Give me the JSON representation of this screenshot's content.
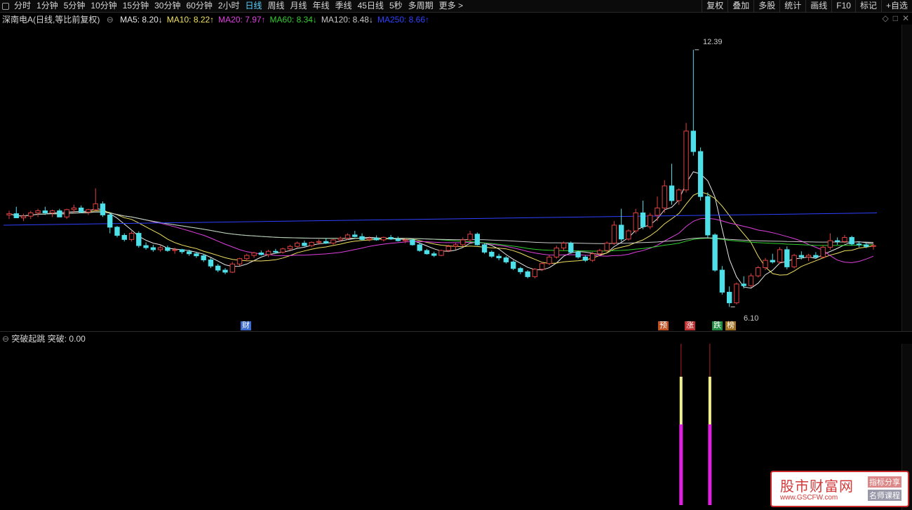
{
  "toolbar": {
    "periods": [
      {
        "label": "分时",
        "active": false
      },
      {
        "label": "1分钟",
        "active": false
      },
      {
        "label": "5分钟",
        "active": false
      },
      {
        "label": "10分钟",
        "active": false
      },
      {
        "label": "15分钟",
        "active": false
      },
      {
        "label": "30分钟",
        "active": false
      },
      {
        "label": "60分钟",
        "active": false
      },
      {
        "label": "2小时",
        "active": false
      },
      {
        "label": "日线",
        "active": true
      },
      {
        "label": "周线",
        "active": false
      },
      {
        "label": "月线",
        "active": false
      },
      {
        "label": "年线",
        "active": false
      },
      {
        "label": "季线",
        "active": false
      },
      {
        "label": "45日线",
        "active": false
      },
      {
        "label": "5秒",
        "active": false
      },
      {
        "label": "多周期",
        "active": false
      },
      {
        "label": "更多 >",
        "active": false
      }
    ],
    "right": [
      "复权",
      "叠加",
      "多股",
      "统计",
      "画线",
      "F10",
      "标记",
      "+自选"
    ]
  },
  "legend": {
    "stock": "深南电A(日线,等比前复权)",
    "ma": [
      {
        "label": "MA5: 8.20↓",
        "color": "#e6e6e6"
      },
      {
        "label": "MA10: 8.22↑",
        "color": "#f0e060"
      },
      {
        "label": "MA20: 7.97↑",
        "color": "#e040e0"
      },
      {
        "label": "MA60: 8.34↓",
        "color": "#30d030"
      },
      {
        "label": "MA120: 8.48↓",
        "color": "#c8c8c8"
      },
      {
        "label": "MA250: 8.66↑",
        "color": "#3040ff"
      }
    ],
    "controls": [
      "◇",
      "□",
      "✕"
    ]
  },
  "price_labels": {
    "high": "12.39",
    "low": "6.10"
  },
  "events": [
    {
      "label": "财",
      "color": "#3a6acb"
    },
    {
      "label": "预",
      "color": "#c05020"
    },
    {
      "label": "涨",
      "color": "#c03030"
    },
    {
      "label": "跌",
      "color": "#208a40"
    },
    {
      "label": "榜",
      "color": "#a07020"
    }
  ],
  "sub_panel": {
    "title": "突破起跳",
    "value_label": "突破: 0.00"
  },
  "watermark": {
    "name": "股市财富网",
    "url": "www.GSCFW.com",
    "tag1": "指标分享",
    "tag2": "名师课程"
  },
  "colors": {
    "up": "#e04040",
    "down": "#4ee0e8",
    "ma5": "#e6e6e6",
    "ma10": "#f0e060",
    "ma20": "#e040e0",
    "ma60": "#30d030",
    "ma120": "#c8c8c8",
    "ma250": "#3040ff"
  },
  "chart_data": {
    "type": "candlestick",
    "ylim": [
      5.8,
      12.8
    ],
    "candles": [
      [
        8.35,
        8.45,
        8.25,
        8.38
      ],
      [
        8.38,
        8.55,
        8.3,
        8.28
      ],
      [
        8.28,
        8.38,
        8.2,
        8.32
      ],
      [
        8.32,
        8.45,
        8.25,
        8.4
      ],
      [
        8.4,
        8.5,
        8.3,
        8.45
      ],
      [
        8.45,
        8.55,
        8.35,
        8.4
      ],
      [
        8.4,
        8.48,
        8.3,
        8.45
      ],
      [
        8.45,
        8.5,
        8.35,
        8.3
      ],
      [
        8.3,
        8.5,
        8.25,
        8.48
      ],
      [
        8.48,
        8.6,
        8.4,
        8.52
      ],
      [
        8.52,
        8.58,
        8.4,
        8.42
      ],
      [
        8.42,
        8.5,
        8.35,
        8.48
      ],
      [
        8.48,
        9.0,
        8.45,
        8.62
      ],
      [
        8.62,
        8.68,
        8.3,
        8.35
      ],
      [
        8.35,
        8.4,
        7.9,
        8.05
      ],
      [
        8.05,
        8.08,
        7.8,
        7.85
      ],
      [
        7.85,
        7.9,
        7.7,
        7.75
      ],
      [
        7.75,
        7.95,
        7.7,
        7.9
      ],
      [
        7.9,
        7.95,
        7.55,
        7.6
      ],
      [
        7.6,
        7.68,
        7.5,
        7.55
      ],
      [
        7.55,
        7.62,
        7.45,
        7.5
      ],
      [
        7.5,
        7.6,
        7.45,
        7.55
      ],
      [
        7.55,
        7.6,
        7.45,
        7.48
      ],
      [
        7.48,
        7.55,
        7.4,
        7.5
      ],
      [
        7.5,
        7.52,
        7.4,
        7.45
      ],
      [
        7.45,
        7.5,
        7.35,
        7.4
      ],
      [
        7.4,
        7.45,
        7.3,
        7.35
      ],
      [
        7.35,
        7.4,
        7.2,
        7.25
      ],
      [
        7.25,
        7.3,
        7.05,
        7.1
      ],
      [
        7.1,
        7.15,
        6.95,
        7.0
      ],
      [
        7.0,
        7.05,
        6.9,
        6.95
      ],
      [
        6.95,
        7.2,
        6.93,
        7.15
      ],
      [
        7.15,
        7.3,
        7.1,
        7.28
      ],
      [
        7.28,
        7.4,
        7.22,
        7.36
      ],
      [
        7.36,
        7.45,
        7.3,
        7.42
      ],
      [
        7.42,
        7.48,
        7.36,
        7.38
      ],
      [
        7.38,
        7.5,
        7.32,
        7.46
      ],
      [
        7.46,
        7.52,
        7.4,
        7.44
      ],
      [
        7.44,
        7.55,
        7.4,
        7.52
      ],
      [
        7.52,
        7.62,
        7.48,
        7.58
      ],
      [
        7.58,
        7.7,
        7.55,
        7.66
      ],
      [
        7.66,
        7.72,
        7.58,
        7.6
      ],
      [
        7.6,
        7.7,
        7.56,
        7.68
      ],
      [
        7.68,
        7.75,
        7.62,
        7.7
      ],
      [
        7.7,
        7.78,
        7.64,
        7.66
      ],
      [
        7.66,
        7.76,
        7.62,
        7.74
      ],
      [
        7.74,
        7.82,
        7.7,
        7.78
      ],
      [
        7.78,
        7.9,
        7.74,
        7.86
      ],
      [
        7.86,
        7.96,
        7.8,
        7.82
      ],
      [
        7.82,
        7.9,
        7.72,
        7.75
      ],
      [
        7.75,
        7.82,
        7.7,
        7.78
      ],
      [
        7.78,
        7.85,
        7.72,
        7.74
      ],
      [
        7.74,
        7.82,
        7.7,
        7.8
      ],
      [
        7.8,
        7.86,
        7.74,
        7.76
      ],
      [
        7.76,
        7.82,
        7.7,
        7.72
      ],
      [
        7.72,
        7.78,
        7.66,
        7.74
      ],
      [
        7.74,
        7.78,
        7.6,
        7.62
      ],
      [
        7.62,
        7.66,
        7.45,
        7.48
      ],
      [
        7.48,
        7.52,
        7.38,
        7.4
      ],
      [
        7.4,
        7.45,
        7.32,
        7.36
      ],
      [
        7.36,
        7.5,
        7.34,
        7.48
      ],
      [
        7.48,
        7.62,
        7.44,
        7.58
      ],
      [
        7.58,
        7.66,
        7.5,
        7.62
      ],
      [
        7.62,
        7.8,
        7.58,
        7.74
      ],
      [
        7.74,
        7.96,
        7.7,
        7.88
      ],
      [
        7.88,
        7.92,
        7.6,
        7.62
      ],
      [
        7.62,
        7.66,
        7.4,
        7.44
      ],
      [
        7.44,
        7.48,
        7.3,
        7.34
      ],
      [
        7.34,
        7.4,
        7.24,
        7.3
      ],
      [
        7.3,
        7.34,
        7.16,
        7.2
      ],
      [
        7.2,
        7.24,
        7.0,
        7.04
      ],
      [
        7.04,
        7.08,
        6.9,
        6.96
      ],
      [
        6.96,
        7.0,
        6.8,
        6.84
      ],
      [
        6.84,
        7.05,
        6.8,
        7.02
      ],
      [
        7.02,
        7.2,
        6.98,
        7.16
      ],
      [
        7.16,
        7.36,
        7.12,
        7.32
      ],
      [
        7.32,
        7.6,
        7.28,
        7.54
      ],
      [
        7.54,
        7.7,
        7.48,
        7.66
      ],
      [
        7.66,
        7.7,
        7.4,
        7.44
      ],
      [
        7.44,
        7.48,
        7.28,
        7.32
      ],
      [
        7.32,
        7.36,
        7.2,
        7.24
      ],
      [
        7.24,
        7.44,
        7.2,
        7.4
      ],
      [
        7.4,
        7.52,
        7.36,
        7.48
      ],
      [
        7.48,
        7.7,
        7.44,
        7.66
      ],
      [
        7.66,
        8.2,
        7.62,
        8.1
      ],
      [
        8.1,
        8.5,
        7.7,
        7.76
      ],
      [
        7.76,
        8.0,
        7.72,
        7.96
      ],
      [
        7.96,
        8.5,
        7.9,
        8.4
      ],
      [
        8.4,
        8.7,
        8.0,
        8.06
      ],
      [
        8.06,
        8.4,
        8.0,
        8.34
      ],
      [
        8.34,
        8.8,
        8.2,
        8.52
      ],
      [
        8.52,
        9.2,
        8.4,
        9.06
      ],
      [
        9.06,
        9.6,
        8.6,
        8.7
      ],
      [
        8.7,
        9.0,
        8.6,
        8.96
      ],
      [
        8.96,
        10.6,
        8.9,
        10.4
      ],
      [
        10.4,
        12.39,
        9.8,
        9.9
      ],
      [
        9.9,
        10.0,
        8.7,
        8.8
      ],
      [
        8.8,
        8.9,
        7.8,
        7.86
      ],
      [
        7.86,
        7.9,
        6.96,
        7.0
      ],
      [
        7.0,
        7.1,
        6.4,
        6.46
      ],
      [
        6.46,
        6.6,
        6.1,
        6.2
      ],
      [
        6.2,
        6.7,
        6.16,
        6.66
      ],
      [
        6.66,
        6.85,
        6.55,
        6.62
      ],
      [
        6.62,
        6.92,
        6.58,
        6.86
      ],
      [
        6.86,
        7.1,
        6.82,
        7.06
      ],
      [
        7.06,
        7.3,
        7.0,
        7.24
      ],
      [
        7.24,
        7.4,
        7.16,
        7.2
      ],
      [
        7.2,
        7.56,
        7.16,
        7.5
      ],
      [
        7.5,
        7.58,
        7.02,
        7.08
      ],
      [
        7.08,
        7.4,
        7.04,
        7.36
      ],
      [
        7.36,
        7.46,
        7.26,
        7.32
      ],
      [
        7.32,
        7.4,
        7.22,
        7.36
      ],
      [
        7.36,
        7.44,
        7.28,
        7.32
      ],
      [
        7.32,
        7.6,
        7.28,
        7.56
      ],
      [
        7.56,
        7.9,
        7.5,
        7.72
      ],
      [
        7.72,
        7.8,
        7.62,
        7.7
      ],
      [
        7.7,
        7.86,
        7.66,
        7.8
      ],
      [
        7.8,
        7.84,
        7.6,
        7.64
      ],
      [
        7.64,
        7.7,
        7.56,
        7.62
      ],
      [
        7.62,
        7.66,
        7.54,
        7.58
      ],
      [
        7.58,
        7.64,
        7.5,
        7.6
      ]
    ],
    "ma250": [
      8.1,
      8.4
    ],
    "sub_bars": [
      {
        "index": 93,
        "value": 1
      },
      {
        "index": 97,
        "value": 1
      }
    ]
  }
}
